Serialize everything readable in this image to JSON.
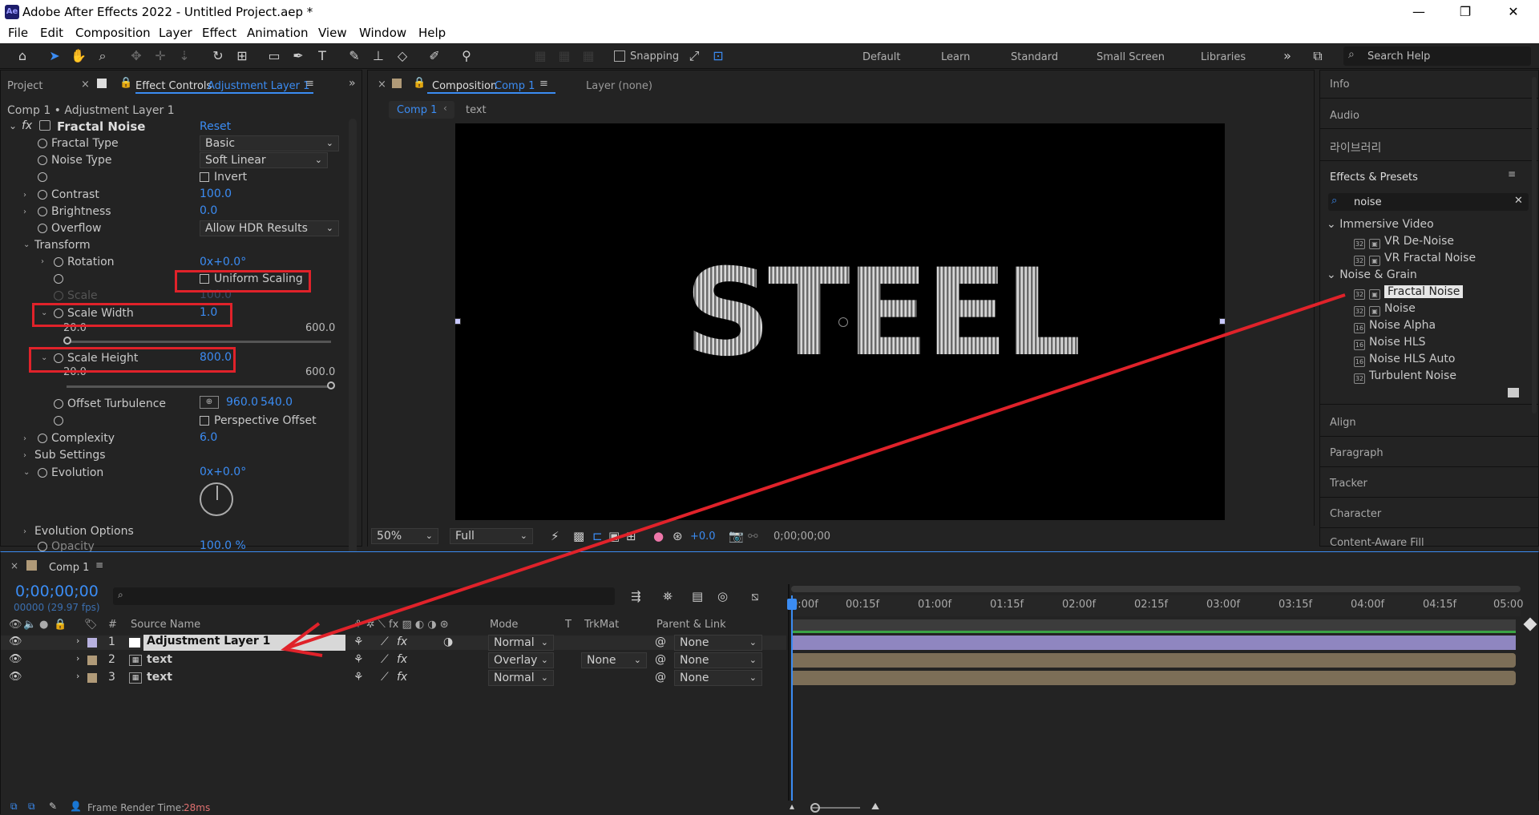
{
  "window": {
    "title": "Adobe After Effects 2022 - Untitled Project.aep *",
    "app_icon": "Ae"
  },
  "menu": [
    "File",
    "Edit",
    "Composition",
    "Layer",
    "Effect",
    "Animation",
    "View",
    "Window",
    "Help"
  ],
  "toolbar": {
    "snapping_label": "Snapping",
    "workspaces": [
      "Default",
      "Learn",
      "Standard",
      "Small Screen",
      "Libraries"
    ],
    "search_placeholder": "Search Help"
  },
  "left_panel": {
    "project_tab": "Project",
    "effect_controls_tab": "Effect Controls",
    "effect_controls_layer": "Adjustment Layer 1",
    "breadcrumb": "Comp 1 • Adjustment Layer 1",
    "effect_name": "Fractal Noise",
    "reset_label": "Reset",
    "props": {
      "fractal_type": {
        "label": "Fractal Type",
        "value": "Basic"
      },
      "noise_type": {
        "label": "Noise Type",
        "value": "Soft Linear"
      },
      "invert": {
        "label": "Invert",
        "checked": false
      },
      "contrast": {
        "label": "Contrast",
        "value": "100.0"
      },
      "brightness": {
        "label": "Brightness",
        "value": "0.0"
      },
      "overflow": {
        "label": "Overflow",
        "value": "Allow HDR Results"
      },
      "transform": {
        "label": "Transform"
      },
      "rotation": {
        "label": "Rotation",
        "value": "0x+0.0°"
      },
      "uniform_scaling": {
        "label": "Uniform Scaling",
        "checked": false
      },
      "scale": {
        "label": "Scale",
        "value": "100.0"
      },
      "scale_width": {
        "label": "Scale Width",
        "value": "1.0",
        "min": "20.0",
        "max": "600.0"
      },
      "scale_height": {
        "label": "Scale Height",
        "value": "800.0",
        "min": "20.0",
        "max": "600.0"
      },
      "offset_turbulence": {
        "label": "Offset Turbulence",
        "value_x": "960.0",
        "value_y": "540.0"
      },
      "perspective_offset": {
        "label": "Perspective Offset",
        "checked": false
      },
      "complexity": {
        "label": "Complexity",
        "value": "6.0"
      },
      "sub_settings": {
        "label": "Sub Settings"
      },
      "evolution": {
        "label": "Evolution",
        "value": "0x+0.0°"
      },
      "evolution_options": {
        "label": "Evolution Options"
      },
      "opacity": {
        "label": "Opacity",
        "value": "100.0 %"
      }
    }
  },
  "composition": {
    "tab_label": "Composition",
    "tab_comp": "Comp 1",
    "layer_label": "Layer (none)",
    "breadcrumbs": [
      "Comp 1",
      "text"
    ],
    "canvas_text": "STEEL",
    "zoom": "50%",
    "resolution": "Full",
    "exposure": "+0.0",
    "timecode": "0;00;00;00"
  },
  "right_panel": {
    "info": "Info",
    "audio": "Audio",
    "libraries_ko": "라이브러리",
    "effects_presets": "Effects & Presets",
    "search_value": "noise",
    "groups": [
      {
        "name": "Immersive Video",
        "items": [
          "VR De-Noise",
          "VR Fractal Noise"
        ]
      },
      {
        "name": "Noise & Grain",
        "items": [
          "Fractal Noise",
          "Noise",
          "Noise Alpha",
          "Noise HLS",
          "Noise HLS Auto",
          "Turbulent Noise"
        ]
      }
    ],
    "selected_item": "Fractal Noise",
    "bottom_panels": [
      "Align",
      "Paragraph",
      "Tracker",
      "Character",
      "Content-Aware Fill"
    ]
  },
  "timeline": {
    "comp_tab": "Comp 1",
    "current_time": "0;00;00;00",
    "frame_info": "00000 (29.97 fps)",
    "columns": {
      "num": "#",
      "source_name": "Source Name",
      "mode": "Mode",
      "t": "T",
      "trkmat": "TrkMat",
      "parent": "Parent & Link"
    },
    "layers": [
      {
        "num": "1",
        "name": "Adjustment Layer 1",
        "mode": "Normal",
        "trkmat": "",
        "parent": "None",
        "color": "#b8b2e0"
      },
      {
        "num": "2",
        "name": "text",
        "mode": "Overlay",
        "trkmat": "None",
        "parent": "None",
        "color": "#b09a78"
      },
      {
        "num": "3",
        "name": "text",
        "mode": "Normal",
        "trkmat": "",
        "parent": "None",
        "color": "#b09a78"
      }
    ],
    "ruler_ticks": [
      "0:00f",
      "00:15f",
      "01:00f",
      "01:15f",
      "02:00f",
      "02:15f",
      "03:00f",
      "03:15f",
      "04:00f",
      "04:15f",
      "05:00"
    ],
    "frame_render_label": "Frame Render Time:",
    "frame_render_value": "28ms"
  },
  "colors": {
    "accent": "#3b8cf3",
    "highlight": "#e0222a",
    "adjustment_bar": "#8f86c0",
    "text_bar": "#7c6e57"
  }
}
